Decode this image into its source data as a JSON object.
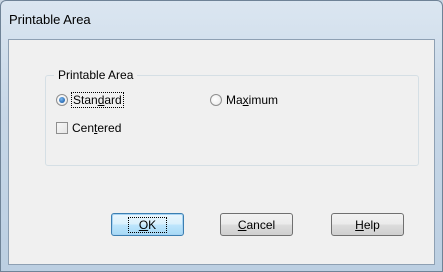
{
  "window": {
    "title": "Printable Area"
  },
  "group": {
    "title": "Printable Area",
    "options": [
      {
        "pre": "Stan",
        "mnemonic": "d",
        "post": "ard",
        "checked": true
      },
      {
        "pre": "Ma",
        "mnemonic": "x",
        "post": "imum",
        "checked": false
      }
    ],
    "centered": {
      "pre": "Cen",
      "mnemonic": "t",
      "post": "ered",
      "checked": false
    }
  },
  "buttons": {
    "ok": {
      "mnemonic": "O",
      "post": "K"
    },
    "cancel": {
      "mnemonic": "C",
      "post": "ancel"
    },
    "help": {
      "mnemonic": "H",
      "post": "elp"
    }
  },
  "colors": {
    "titlebar": "#c7d7e7",
    "client": "#f0f0f0",
    "default_button_border": "#3c7fb1"
  }
}
